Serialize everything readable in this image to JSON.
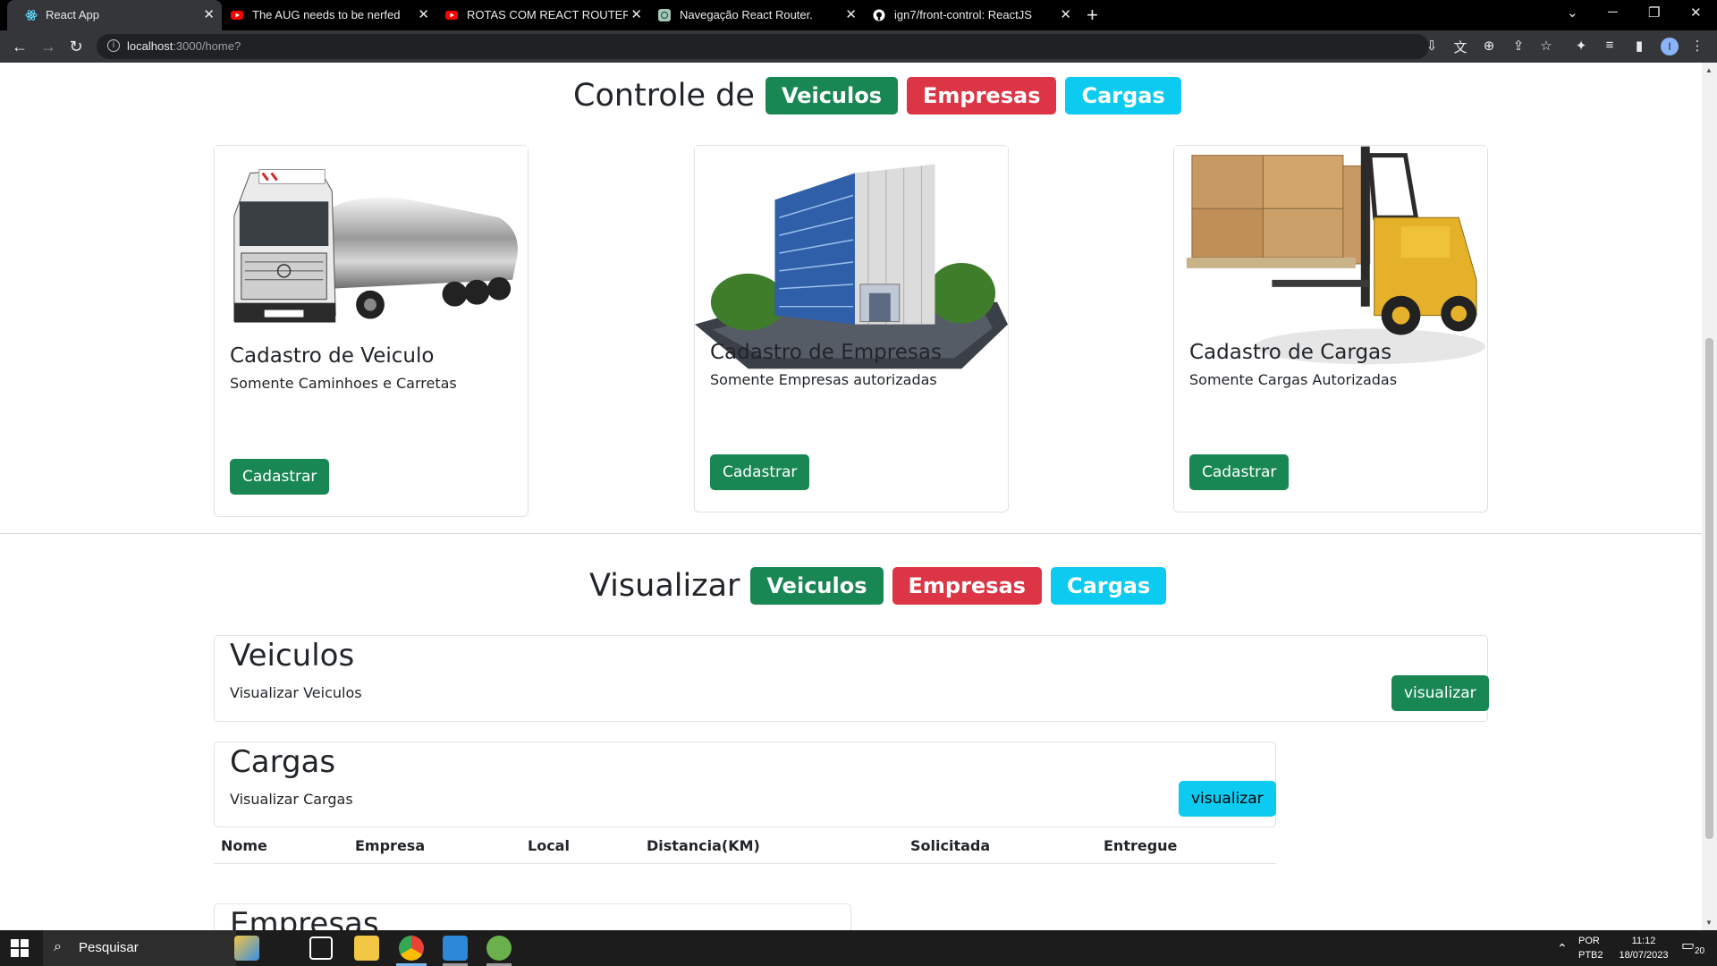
{
  "browser": {
    "tabs": [
      {
        "title": "React App",
        "icon": "react-icon",
        "active": true
      },
      {
        "title": "The AUG needs to be nerfed in P",
        "icon": "youtube-icon"
      },
      {
        "title": "ROTAS COM REACT ROUTER DO",
        "icon": "youtube-icon"
      },
      {
        "title": "Navegação React Router.",
        "icon": "chatgpt-icon"
      },
      {
        "title": "ign7/front-control: ReactJS",
        "icon": "github-icon"
      }
    ],
    "new_tab": "+",
    "url_host": "localhost",
    "url_rest": ":3000/home?"
  },
  "controle": {
    "heading": "Controle de",
    "badges": [
      "Veiculos",
      "Empresas",
      "Cargas"
    ]
  },
  "cards": [
    {
      "title": "Cadastro de Veiculo",
      "text": "Somente Caminhoes e Carretas",
      "button": "Cadastrar",
      "image": "tanker-truck"
    },
    {
      "title": "Cadastro de Empresas",
      "text": "Somente Empresas autorizadas",
      "button": "Cadastrar",
      "image": "office-building"
    },
    {
      "title": "Cadastro de Cargas",
      "text": "Somente Cargas Autorizadas",
      "button": "Cadastrar",
      "image": "forklift-boxes"
    }
  ],
  "visualizar": {
    "heading": "Visualizar",
    "badges": [
      "Veiculos",
      "Empresas",
      "Cargas"
    ]
  },
  "veiculos_panel": {
    "title": "Veiculos",
    "text": "Visualizar Veiculos",
    "button": "visualizar"
  },
  "cargas_panel": {
    "title": "Cargas",
    "text": "Visualizar Cargas",
    "button": "visualizar",
    "columns": [
      "Nome",
      "Empresa",
      "Local",
      "Distancia(KM)",
      "Solicitada",
      "Entregue"
    ]
  },
  "empresas_panel": {
    "title": "Empresas"
  },
  "taskbar": {
    "search_placeholder": "Pesquisar",
    "lang_1": "POR",
    "lang_2": "PTB2",
    "time": "11:12",
    "date": "18/07/2023",
    "notifications": "20"
  },
  "colors": {
    "success": "#198754",
    "danger": "#dc3545",
    "info": "#0dcaf0"
  }
}
